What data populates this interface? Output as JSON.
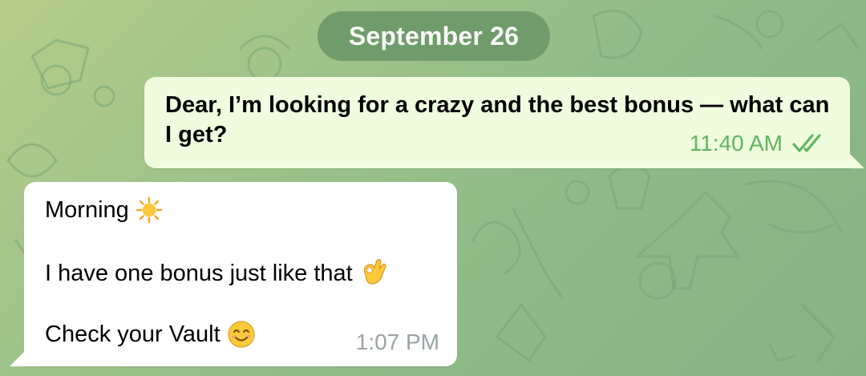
{
  "chat": {
    "date_separator": "September 26",
    "messages": [
      {
        "direction": "outgoing",
        "text": "Dear, I’m looking for a crazy and the best bonus — what can I get?",
        "time": "11:40 AM",
        "status_icon": "double-check-icon"
      },
      {
        "direction": "incoming",
        "lines": [
          "Morning",
          "I have one bonus just like that",
          "Check your Vault"
        ],
        "emojis": [
          "sun-emoji",
          "ok-hand-emoji",
          "smiling-face-emoji"
        ],
        "time": "1:07 PM"
      }
    ]
  },
  "colors": {
    "background": "#9fc38a",
    "date_pill": "#6e9a6a",
    "outgoing_bubble": "#effdde",
    "outgoing_meta": "#5fb560",
    "incoming_bubble": "#ffffff",
    "incoming_meta": "#9aa3a6"
  }
}
